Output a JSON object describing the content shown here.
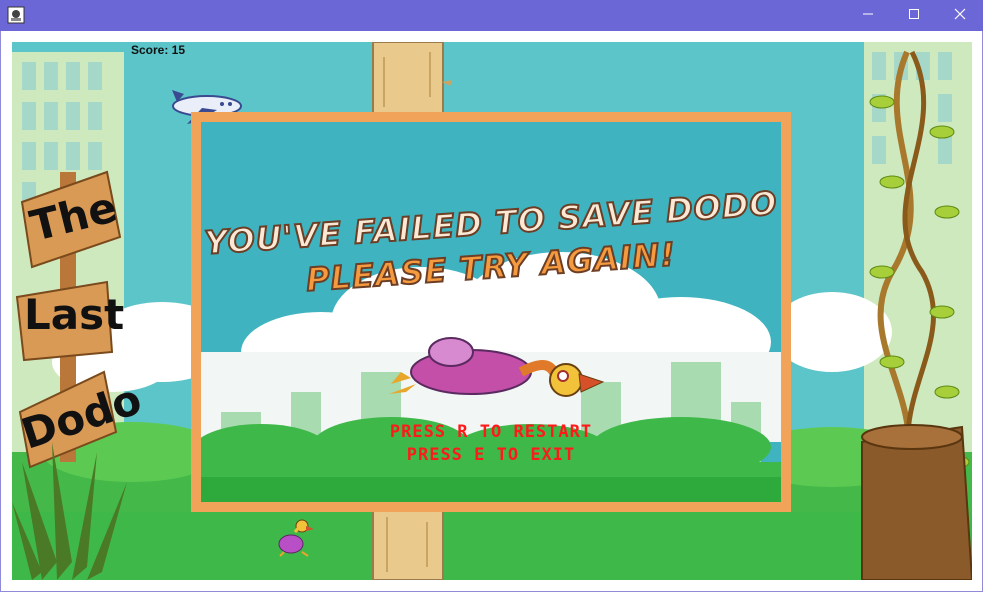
{
  "window": {
    "app_icon": "java-app-icon",
    "controls": [
      "minimize-icon",
      "maximize-icon",
      "close-icon"
    ]
  },
  "hud": {
    "score_text": "Score: 15"
  },
  "sign": {
    "words": [
      "The",
      "Last",
      "Dodo"
    ]
  },
  "game_over": {
    "title_line1": "YOU'VE FAILED TO SAVE DODO",
    "title_line2": "PLEASE TRY AGAIN!",
    "restart_text": "PRESS R TO RESTART",
    "exit_text": "PRESS E TO EXIT"
  },
  "colors": {
    "titlebar": "#6b67d6",
    "sky": "#5cc5c9",
    "grass": "#3fb84a",
    "overlay_border": "#f2a35a",
    "prompt_text": "#ff1a1a"
  }
}
